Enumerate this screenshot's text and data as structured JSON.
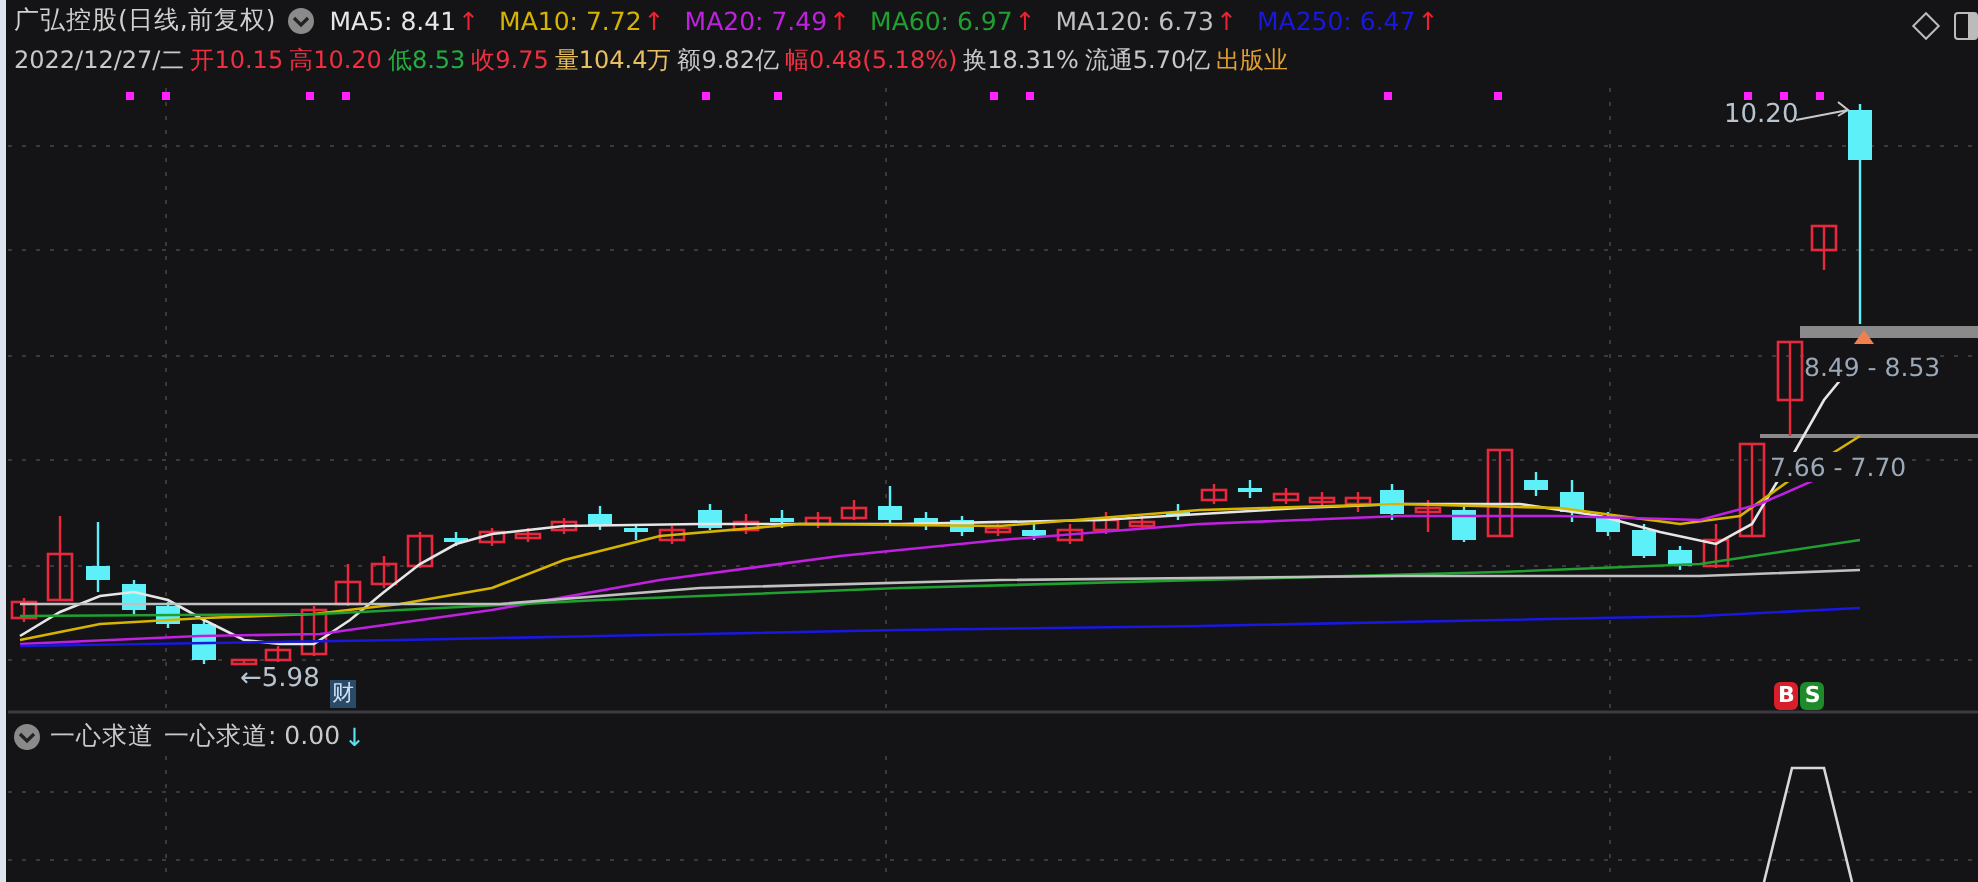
{
  "header": {
    "title": "广弘控股(日线,前复权)",
    "moving_averages": [
      {
        "label": "MA5: 8.41",
        "color": "#e6e6e6",
        "arrow": "↑"
      },
      {
        "label": "MA10: 7.72",
        "color": "#d6b400",
        "arrow": "↑"
      },
      {
        "label": "MA20: 7.49",
        "color": "#c020e0",
        "arrow": "↑"
      },
      {
        "label": "MA60: 6.97",
        "color": "#20a030",
        "arrow": "↑"
      },
      {
        "label": "MA120: 6.73",
        "color": "#c0c0c0",
        "arrow": "↑"
      },
      {
        "label": "MA250: 6.47",
        "color": "#1818e0",
        "arrow": "↑"
      }
    ],
    "quote": [
      {
        "text": "2022/12/27/二",
        "color": "#c8c8c8"
      },
      {
        "text": "开10.15",
        "color": "#f03040"
      },
      {
        "text": "高10.20",
        "color": "#f03040"
      },
      {
        "text": "低8.53",
        "color": "#20b040"
      },
      {
        "text": "收9.75",
        "color": "#f03040"
      },
      {
        "text": "量104.4万",
        "color": "#e8c060"
      },
      {
        "text": "额9.82亿",
        "color": "#c8c8c8"
      },
      {
        "text": "幅0.48(5.18%)",
        "color": "#f03040"
      },
      {
        "text": "换18.31%",
        "color": "#c8c8c8"
      },
      {
        "text": "流通5.70亿",
        "color": "#c8c8c8"
      },
      {
        "text": "出版业",
        "color": "#e0a030"
      }
    ]
  },
  "chart": {
    "high_label": "10.20",
    "low_label": "←5.98",
    "event_badge": "财",
    "gaps": [
      {
        "label": "8.49 - 8.53"
      },
      {
        "label": "7.66 - 7.70"
      }
    ],
    "signals": [
      {
        "text": "B",
        "color": "#d81e28"
      },
      {
        "text": "S",
        "color": "#1e8a2a"
      }
    ]
  },
  "indicator": {
    "name": "一心求道",
    "reading": "一心求道: 0.00",
    "arrow": "↓"
  }
}
